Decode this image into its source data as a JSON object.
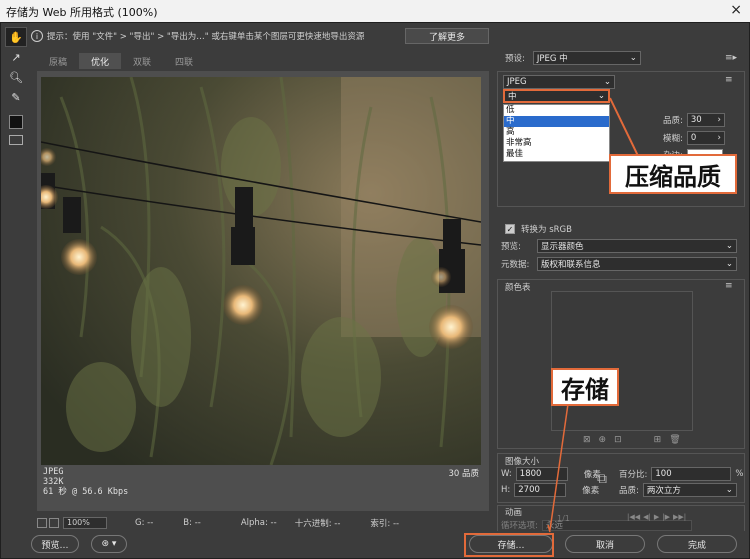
{
  "window": {
    "title": "存储为 Web 所用格式 (100%)",
    "close_glyph": "×"
  },
  "infobar": {
    "tip": "提示：使用 \"文件\" > \"导出\" > \"导出为…\" 或右键单击某个图层可更快速地导出资源",
    "learn_more": "了解更多"
  },
  "tabs": [
    "原稿",
    "优化",
    "双联",
    "四联"
  ],
  "image_info": {
    "format": "JPEG",
    "size": "332K",
    "time": "61 秒 @ 56.6 Kbps",
    "quality": "30 品质"
  },
  "status_bar": {
    "zoom": "100%",
    "g": "G: --",
    "b": "B: --",
    "alpha": "Alpha: --",
    "hex": "十六进制: --",
    "index": "索引: --"
  },
  "bottom_buttons": {
    "preview": "预览…",
    "save": "存储…",
    "cancel": "取消",
    "done": "完成"
  },
  "right_panel": {
    "preset_label": "预设:",
    "preset_value": "JPEG 中",
    "format_value": "JPEG",
    "compression_value": "中",
    "compression_options": [
      "低",
      "中",
      "高",
      "非常高",
      "最佳"
    ],
    "quality_label": "品质:",
    "quality_value": "30",
    "blur_label": "模糊:",
    "blur_value": "0",
    "matte_label": "杂边:",
    "convert_srgb": "转换为 sRGB",
    "preview_label": "预览:",
    "preview_value": "显示器颜色",
    "metadata_label": "元数据:",
    "metadata_value": "版权和联系信息",
    "color_table_title": "颜色表",
    "image_size_title": "图像大小",
    "width_label": "W:",
    "width_value": "1800",
    "height_label": "H:",
    "height_value": "2700",
    "unit": "像素",
    "percent_label": "百分比:",
    "percent_value": "100",
    "percent_unit": "%",
    "quality2_label": "品质:",
    "quality2_value": "两次立方",
    "animation_title": "动画",
    "loop_label": "循环选项:",
    "loop_value": "永远",
    "frame_counter": "1/1"
  },
  "callouts": {
    "compression": "压缩品质",
    "save": "存储"
  },
  "colors": {
    "accent": "#e26a3a"
  }
}
